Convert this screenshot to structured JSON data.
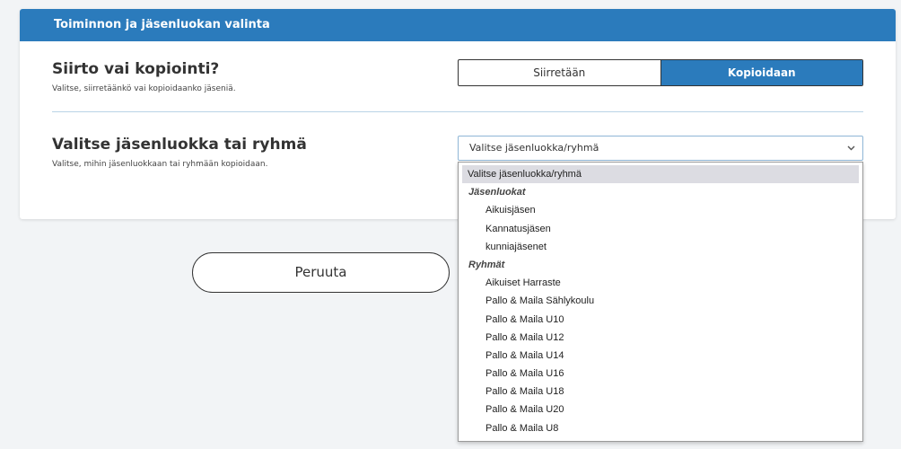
{
  "card": {
    "header_title": "Toiminnon ja jäsenluokan valinta"
  },
  "move_copy": {
    "title": "Siirto vai kopiointi?",
    "subtitle": "Valitse, siirretäänkö vai kopioidaanko jäseniä.",
    "options": [
      "Siirretään",
      "Kopioidaan"
    ],
    "selected": "Kopioidaan"
  },
  "target": {
    "title": "Valitse jäsenluokka tai ryhmä",
    "subtitle": "Valitse, mihin jäsenluokkaan tai ryhmään kopioidaan.",
    "select_value": "Valitse jäsenluokka/ryhmä",
    "chevron_icon": "chevron-down-icon"
  },
  "cancel_button": "Peruuta",
  "dropdown": {
    "placeholder": "Valitse jäsenluokka/ryhmä",
    "groups": [
      {
        "label": "Jäsenluokat",
        "items": [
          "Aikuisjäsen",
          "Kannatusjäsen",
          "kunniajäsenet"
        ]
      },
      {
        "label": "Ryhmät",
        "items": [
          "Aikuiset Harraste",
          "Pallo & Maila Sählykoulu",
          "Pallo & Maila U10",
          "Pallo & Maila U12",
          "Pallo & Maila U14",
          "Pallo & Maila U16",
          "Pallo & Maila U18",
          "Pallo & Maila U20",
          "Pallo & Maila U8"
        ]
      }
    ]
  },
  "colors": {
    "accent": "#2b7bbc",
    "background": "#f2f4f6"
  }
}
